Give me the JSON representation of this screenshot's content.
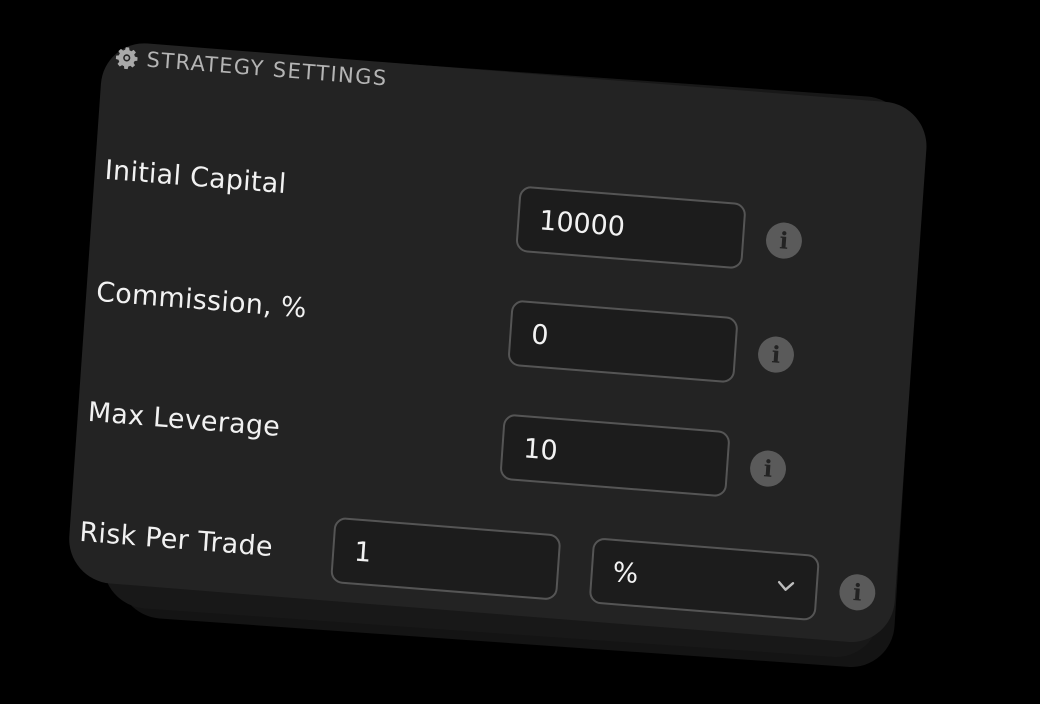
{
  "header": {
    "icon": "gear-icon",
    "title": "STRATEGY SETTINGS"
  },
  "fields": [
    {
      "label": "Initial Capital",
      "value": "10000"
    },
    {
      "label": "Commission, %",
      "value": "0"
    },
    {
      "label": "Max Leverage",
      "value": "10"
    },
    {
      "label": "Risk Per Trade",
      "value": "1",
      "unit": "%"
    }
  ],
  "info_glyph": "i",
  "colors": {
    "background": "#000000",
    "panel": "#232323",
    "field_border": "#555555",
    "text": "#f1f1f1",
    "info_badge": "#5a5a5a"
  }
}
